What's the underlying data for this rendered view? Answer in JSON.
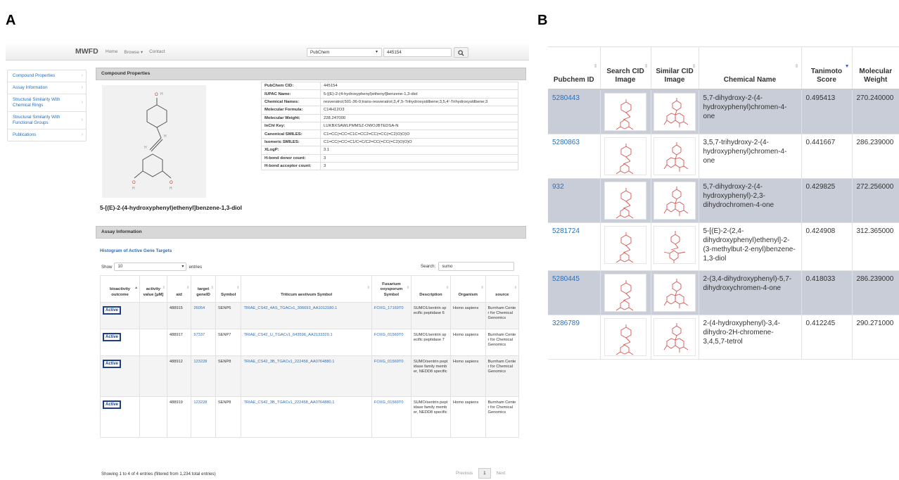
{
  "panels": {
    "a": "A",
    "b": "B"
  },
  "navbar": {
    "brand": "MWFD",
    "links": [
      "Home",
      "Browse ▾",
      "Contact"
    ],
    "db_select": "PubChem",
    "search_value": "445154"
  },
  "sidebar": {
    "items": [
      {
        "label": "Compound Properties"
      },
      {
        "label": "Assay Information"
      },
      {
        "label": "Structural Similarity With Chemical Rings"
      },
      {
        "label": "Structural Similarity With Functional Groups"
      },
      {
        "label": "Publications"
      }
    ]
  },
  "compound": {
    "section_title": "Compound Properties",
    "name": "5-[(E)-2-(4-hydroxyphenyl)ethenyl]benzene-1,3-diol",
    "properties": [
      {
        "key": "PubChem CID:",
        "value": "445154"
      },
      {
        "key": "IUPAC Name:",
        "value": "5-[(E)-2-(4-hydroxyphenyl)ethenyl]benzene-1,3-diol"
      },
      {
        "key": "Chemical Names:",
        "value": "resveratrol;501-36-0;trans-resveratrol;3,4',5-Trihydroxystilbene;3,5,4'-Trihydroxystilbene;3"
      },
      {
        "key": "Molecular Formula:",
        "value": "C14H12O3"
      },
      {
        "key": "Molecular Weight:",
        "value": "228.247000"
      },
      {
        "key": "InChI Key:",
        "value": "LUKBXSAWLPMMSZ-OWOJBTEDSA-N"
      },
      {
        "key": "Canonical SMILES:",
        "value": "C1=CC(=CC=C1C=CC2=CC(=CC(=C2)O)O)O"
      },
      {
        "key": "Isomeric SMILES:",
        "value": "C1=CC(=CC=C1/C=C/C2=CC(=CC(=C2)O)O)O"
      },
      {
        "key": "XLogP:",
        "value": "3.1"
      },
      {
        "key": "H-bond donor count:",
        "value": "3"
      },
      {
        "key": "H-bond acceptor count:",
        "value": "3"
      }
    ]
  },
  "assay": {
    "section_title": "Assay Information",
    "histogram_link": "Histogram of Active Gene Targets",
    "show_label": "Show",
    "entries_value": "10",
    "entries_label": "entries",
    "search_label": "Search:",
    "search_value": "sumo",
    "columns": [
      "bioactivity outcome",
      "activity value [µM]",
      "aid",
      "target geneID",
      "Symbol",
      "Triticum aestivum Symbol",
      "Fusarium oxysporum Symbol",
      "Description",
      "Organism",
      "source"
    ],
    "rows": [
      {
        "outcome": "Active",
        "activity": "",
        "aid": "488915",
        "gene_id": "26054",
        "symbol": "SENP6",
        "triticum": "TRIAE_CS42_4AS_TGACv1_306693_AA1012180.1",
        "fusarium": "FOXG_17169T0",
        "description": "SUMO1/sentrin specific peptidase 6",
        "organism": "Homo sapiens",
        "source": "Burnham Center for Chemical Genomics"
      },
      {
        "outcome": "Active",
        "activity": "",
        "aid": "488917",
        "gene_id": "57337",
        "symbol": "SENP7",
        "triticum": "TRIAE_CS42_U_TGACv1_643596_AA2133320.1",
        "fusarium": "FOXG_01569T0",
        "description": "SUMO1/sentrin specific peptidase 7",
        "organism": "Homo sapiens",
        "source": "Burnham Center for Chemical Genomics"
      },
      {
        "outcome": "Active",
        "activity": "",
        "aid": "488912",
        "gene_id": "123228",
        "symbol": "SENP8",
        "triticum": "TRIAE_CS42_3B_TGACv1_222458_AA0764880.1",
        "fusarium": "FOXG_01569T0",
        "description": "SUMO/sentrin peptidase family member, NEDD8 specific",
        "organism": "Homo sapiens",
        "source": "Burnham Center for Chemical Genomics"
      },
      {
        "outcome": "Active",
        "activity": "",
        "aid": "488919",
        "gene_id": "123228",
        "symbol": "SENP8",
        "triticum": "TRIAE_CS42_3B_TGACv1_222458_AA0764880.1",
        "fusarium": "FOXG_01569T0",
        "description": "SUMO/sentrin peptidase family member, NEDD8 specific",
        "organism": "Homo sapiens",
        "source": "Burnham Center for Chemical Genomics"
      }
    ],
    "info": "Showing 1 to 4 of 4 entries (filtered from 1,234 total entries)",
    "pager": {
      "previous": "Previous",
      "page": "1",
      "next": "Next"
    }
  },
  "similarity": {
    "columns": [
      "Pubchem ID",
      "Search CID Image",
      "Similar CID Image",
      "Chemical Name",
      "Tanimoto Score",
      "Molecular Weight"
    ],
    "rows": [
      {
        "cid": "5280443",
        "name": "5,7-dihydroxy-2-(4-hydroxyphenyl)chromen-4-one",
        "score": "0.495413",
        "mw": "270.240000"
      },
      {
        "cid": "5280863",
        "name": "3,5,7-trihydroxy-2-(4-hydroxyphenyl)chromen-4-one",
        "score": "0.441667",
        "mw": "286.239000"
      },
      {
        "cid": "932",
        "name": "5,7-dihydroxy-2-(4-hydroxyphenyl)-2,3-dihydrochromen-4-one",
        "score": "0.429825",
        "mw": "272.256000"
      },
      {
        "cid": "5281724",
        "name": "5-[(E)-2-(2,4-dihydroxyphenyl)ethenyl]-2-(3-methylbut-2-enyl)benzene-1,3-diol",
        "score": "0.424908",
        "mw": "312.365000"
      },
      {
        "cid": "5280445",
        "name": "2-(3,4-dihydroxyphenyl)-5,7-dihydroxychromen-4-one",
        "score": "0.418033",
        "mw": "286.239000"
      },
      {
        "cid": "3286789",
        "name": "2-(4-hydroxyphenyl)-3,4-dihydro-2H-chromene-3,4,5,7-tetrol",
        "score": "0.412245",
        "mw": "290.271000"
      }
    ]
  },
  "colors": {
    "link": "#2a6ebb",
    "badge": "#1c3f8a",
    "shaded_row": "#c9cdd7",
    "bond_red": "#d9534f"
  }
}
